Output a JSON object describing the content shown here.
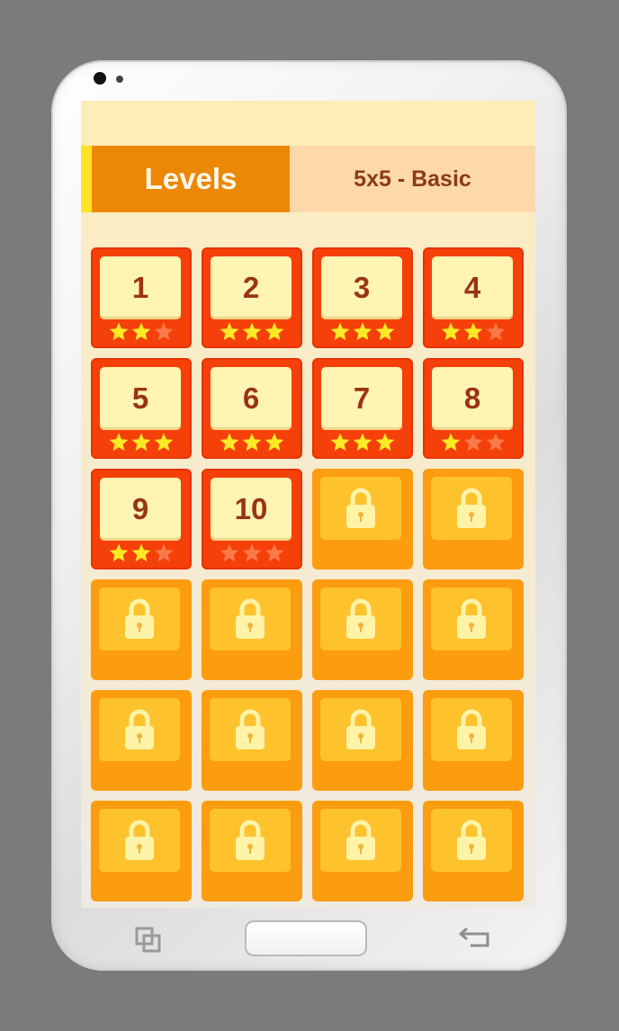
{
  "header": {
    "title": "Levels",
    "mode": "5x5 - Basic"
  },
  "colors": {
    "star_on": "#fcea25",
    "star_off": "#fb7a4a",
    "lock": "#fff3a8"
  },
  "levels": [
    {
      "label": "1",
      "locked": false,
      "stars": 2
    },
    {
      "label": "2",
      "locked": false,
      "stars": 3
    },
    {
      "label": "3",
      "locked": false,
      "stars": 3
    },
    {
      "label": "4",
      "locked": false,
      "stars": 2
    },
    {
      "label": "5",
      "locked": false,
      "stars": 3
    },
    {
      "label": "6",
      "locked": false,
      "stars": 3
    },
    {
      "label": "7",
      "locked": false,
      "stars": 3
    },
    {
      "label": "8",
      "locked": false,
      "stars": 1
    },
    {
      "label": "9",
      "locked": false,
      "stars": 2
    },
    {
      "label": "10",
      "locked": false,
      "stars": 0
    },
    {
      "locked": true
    },
    {
      "locked": true
    },
    {
      "locked": true
    },
    {
      "locked": true
    },
    {
      "locked": true
    },
    {
      "locked": true
    },
    {
      "locked": true
    },
    {
      "locked": true
    },
    {
      "locked": true
    },
    {
      "locked": true
    },
    {
      "locked": true
    },
    {
      "locked": true
    },
    {
      "locked": true
    },
    {
      "locked": true
    }
  ],
  "nav": {
    "icons": [
      "recent-apps-icon",
      "home-button",
      "back-arrow-icon"
    ]
  }
}
